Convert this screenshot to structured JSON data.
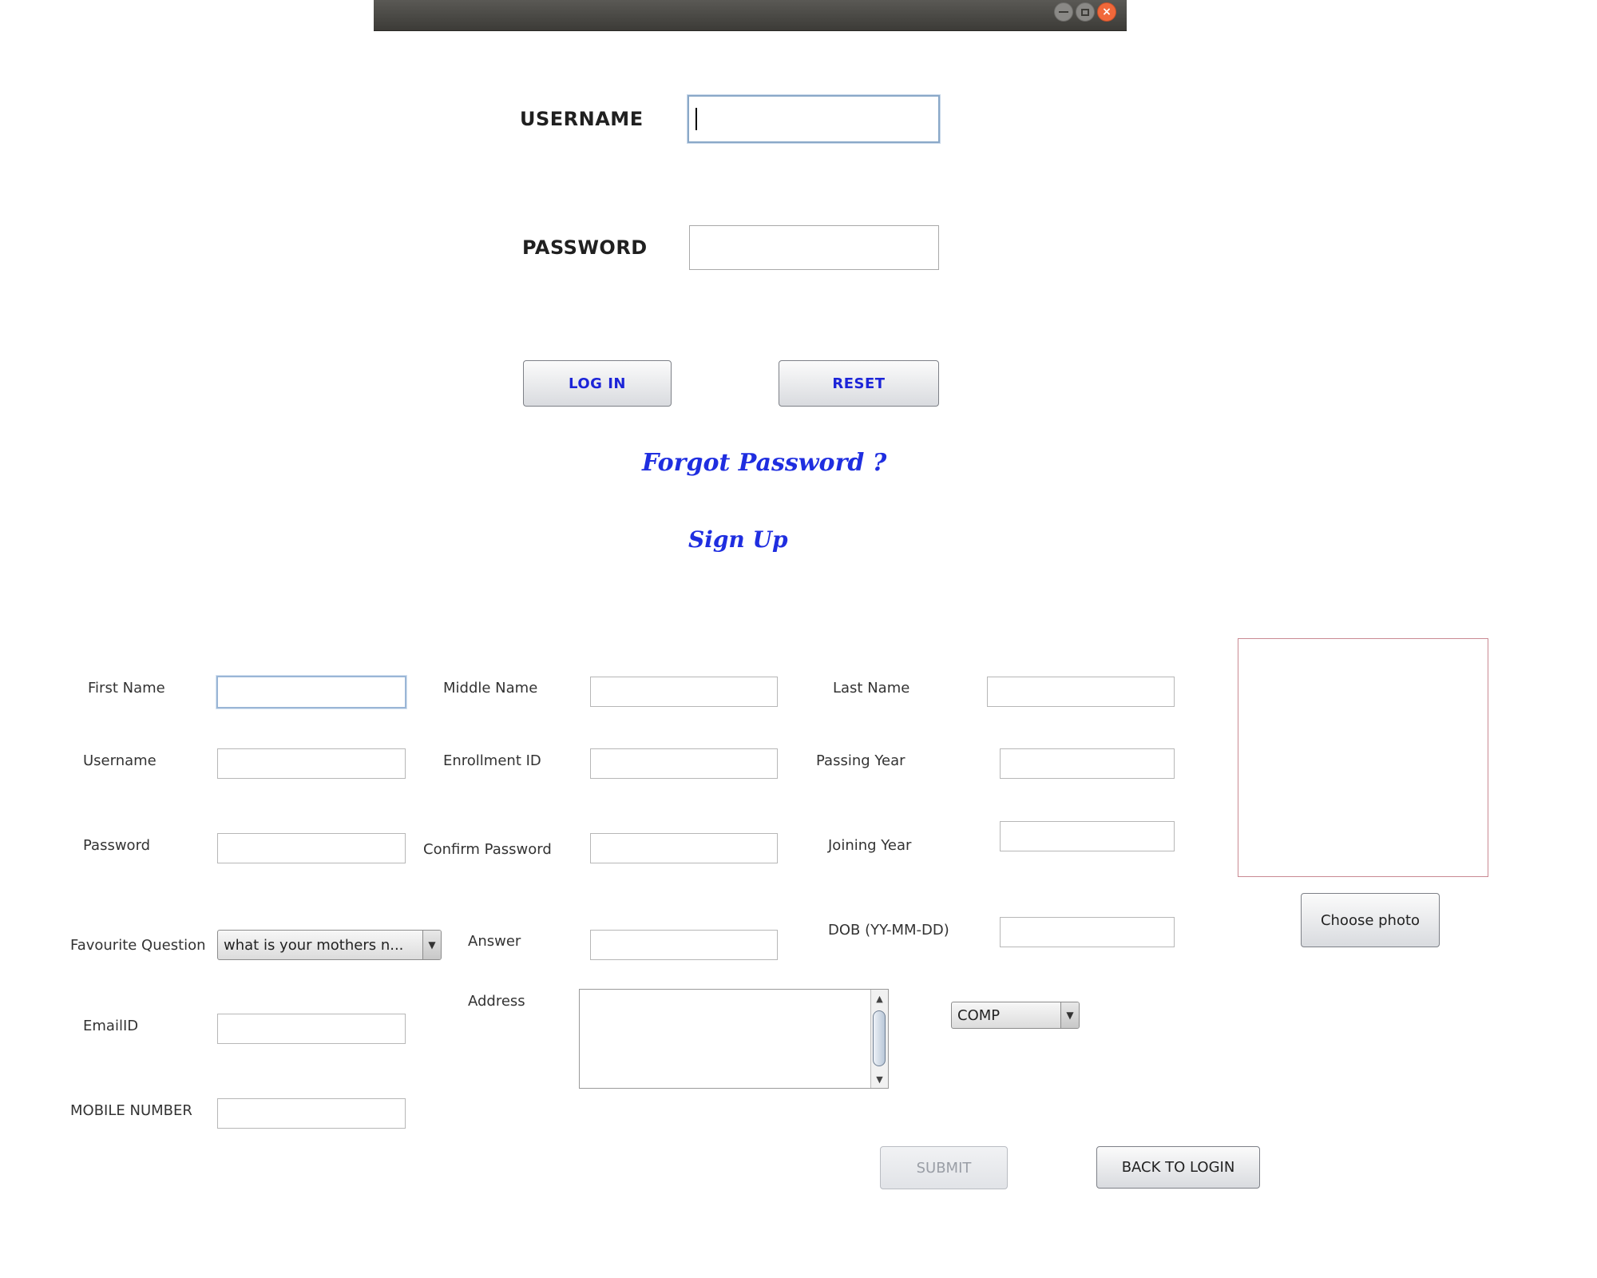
{
  "window": {
    "controls": {
      "minimize_icon": "minimize-icon",
      "maximize_icon": "maximize-icon",
      "close_icon": "close-icon",
      "close_glyph": "×",
      "close_color": "#f1683a"
    }
  },
  "login": {
    "username_label": "USERNAME",
    "username_value": "",
    "password_label": "PASSWORD",
    "password_value": "",
    "login_button": "LOG IN",
    "reset_button": "RESET",
    "forgot_password_link": "Forgot Password ?",
    "sign_up_link": "Sign Up",
    "link_color": "#1f2ee0"
  },
  "signup": {
    "first_name_label": "First Name",
    "middle_name_label": "Middle Name",
    "last_name_label": "Last Name",
    "username_label": "Username",
    "enrollment_id_label": "Enrollment ID",
    "passing_year_label": "Passing Year",
    "password_label": "Password",
    "confirm_password_label": "Confirm Password",
    "joining_year_label": "Joining Year",
    "favourite_question_label": "Favourite Question",
    "favourite_question_value": "what is your mothers n...",
    "answer_label": "Answer",
    "dob_label": "DOB (YY-MM-DD)",
    "address_label": "Address",
    "department_value": "COMP",
    "email_label": "EmailID",
    "mobile_label": "MOBILE NUMBER",
    "choose_photo_button": "Choose photo",
    "submit_button": "SUBMIT",
    "back_to_login_button": "BACK TO LOGIN",
    "combo_arrow": "▼",
    "scroll_up": "▲",
    "scroll_down": "▼"
  }
}
